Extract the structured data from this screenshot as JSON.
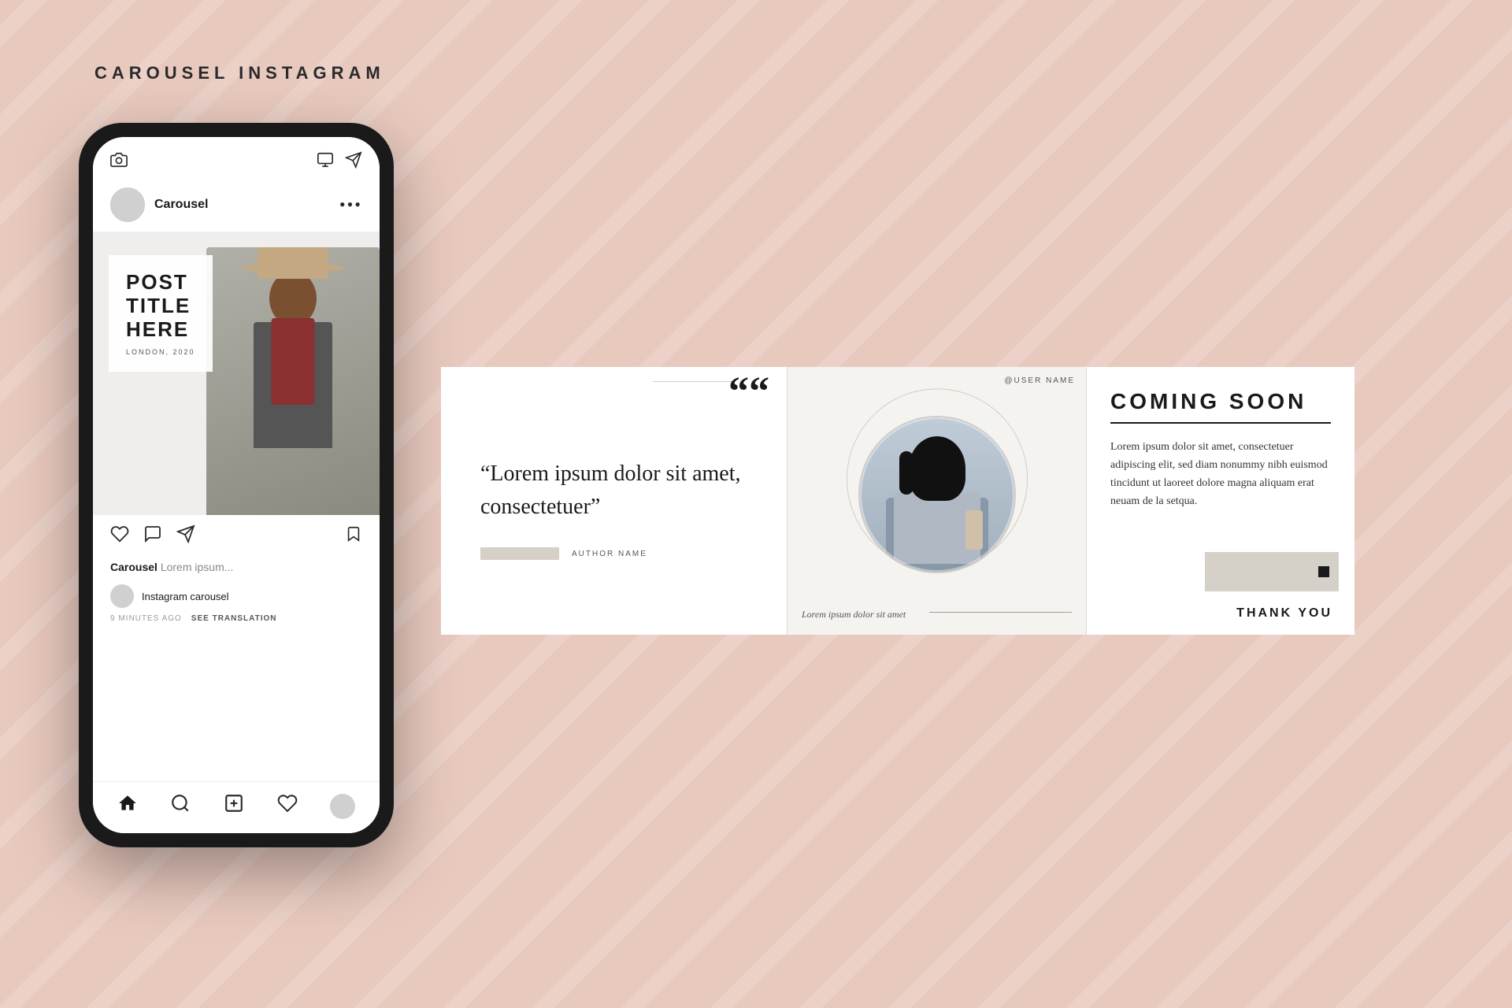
{
  "page": {
    "title": "CAROUSEL INSTAGRAM",
    "background_color": "#e8c9be"
  },
  "phone": {
    "username": "Carousel",
    "post_title": "POST\nTITLE\nHERE",
    "post_location": "LONDON, 2020",
    "caption_username": "Carousel",
    "caption_preview": "Lorem ipsum...",
    "instagram_carousel_label": "Instagram carousel",
    "time_ago": "9 MINUTES AGO",
    "see_translation": "SEE TRANSLATION",
    "dots_menu": "•••"
  },
  "panel_quote": {
    "quote_mark": "““",
    "quote_text": "“Lorem ipsum dolor sit amet, consectetuer”",
    "author_label": "AUTHOR NAME"
  },
  "panel_profile": {
    "username_tag": "@USER NAME",
    "caption": "Lorem ipsum dolor sit amet"
  },
  "panel_coming_soon": {
    "title": "COMING SOON",
    "body_text": "Lorem ipsum dolor sit amet, consectetuer adipiscing elit, sed diam nonummy nibh euismod tincidunt ut laoreet dolore magna aliquam erat neuam de la setqua.",
    "thank_you": "THANK YOU"
  }
}
